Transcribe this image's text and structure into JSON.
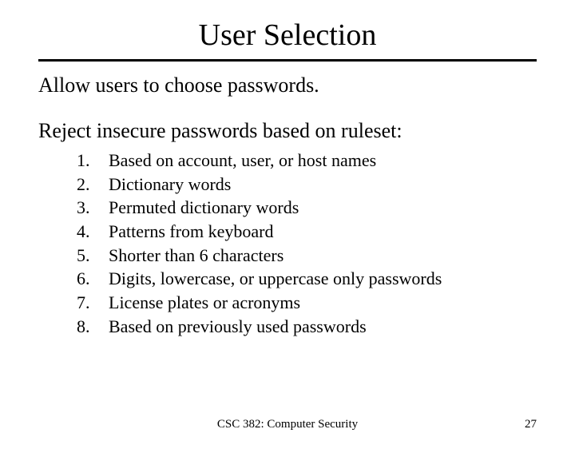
{
  "title": "User Selection",
  "para1": "Allow users to choose passwords.",
  "para2": "Reject insecure passwords based on ruleset:",
  "rules": [
    "Based on account, user, or host names",
    "Dictionary words",
    "Permuted dictionary words",
    "Patterns from keyboard",
    "Shorter than 6 characters",
    "Digits, lowercase, or uppercase only passwords",
    "License plates or acronyms",
    "Based on previously used passwords"
  ],
  "footer_center": "CSC 382: Computer Security",
  "footer_right": "27"
}
